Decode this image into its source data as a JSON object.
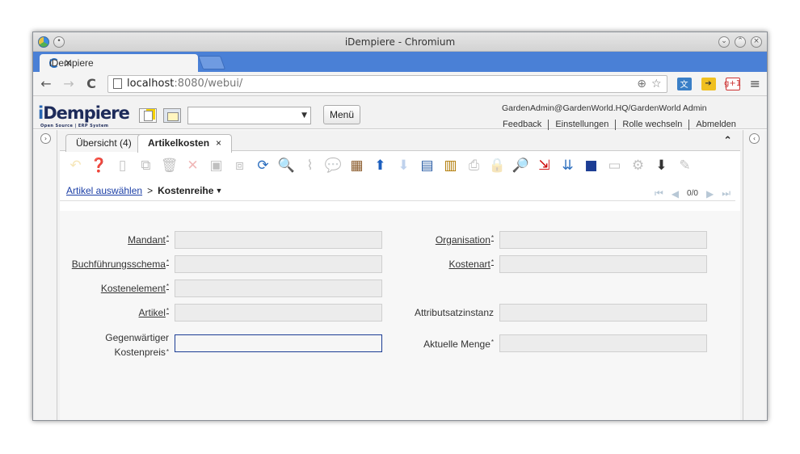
{
  "window": {
    "title": "iDempiere - Chromium",
    "tab_title": "iDempiere",
    "tab_close": "×"
  },
  "browser": {
    "url_host": "localhost",
    "url_rest": ":8080/webui/"
  },
  "header": {
    "logo_main": "Dempiere",
    "logo_i": "i",
    "logo_sub": "Open Source | ERP System",
    "menu_button": "Menü",
    "user_info": "GardenAdmin@GardenWorld.HQ/GardenWorld Admin",
    "links": [
      "Feedback",
      "Einstellungen",
      "Rolle wechseln",
      "Abmelden"
    ]
  },
  "tabs": [
    {
      "label": "Übersicht (4)"
    },
    {
      "label": "Artikelkosten",
      "close": "×"
    }
  ],
  "breadcrumb": {
    "parent": "Artikel auswählen",
    "separator": ">",
    "current": "Kostenreihe",
    "caret": "▼"
  },
  "pager": {
    "count": "0/0"
  },
  "form": {
    "mandant": "Mandant",
    "organisation": "Organisation",
    "buchfuehrungsschema": "Buchführungsschema",
    "kostenart": "Kostenart",
    "kostenelement": "Kostenelement",
    "artikel": "Artikel",
    "attributsatzinstanz": "Attributsatzinstanz",
    "kostenpreis_line1": "Gegenwärtiger",
    "kostenpreis_line2": "Kostenpreis",
    "aktuelle_menge": "Aktuelle Menge",
    "required_mark": "*"
  }
}
